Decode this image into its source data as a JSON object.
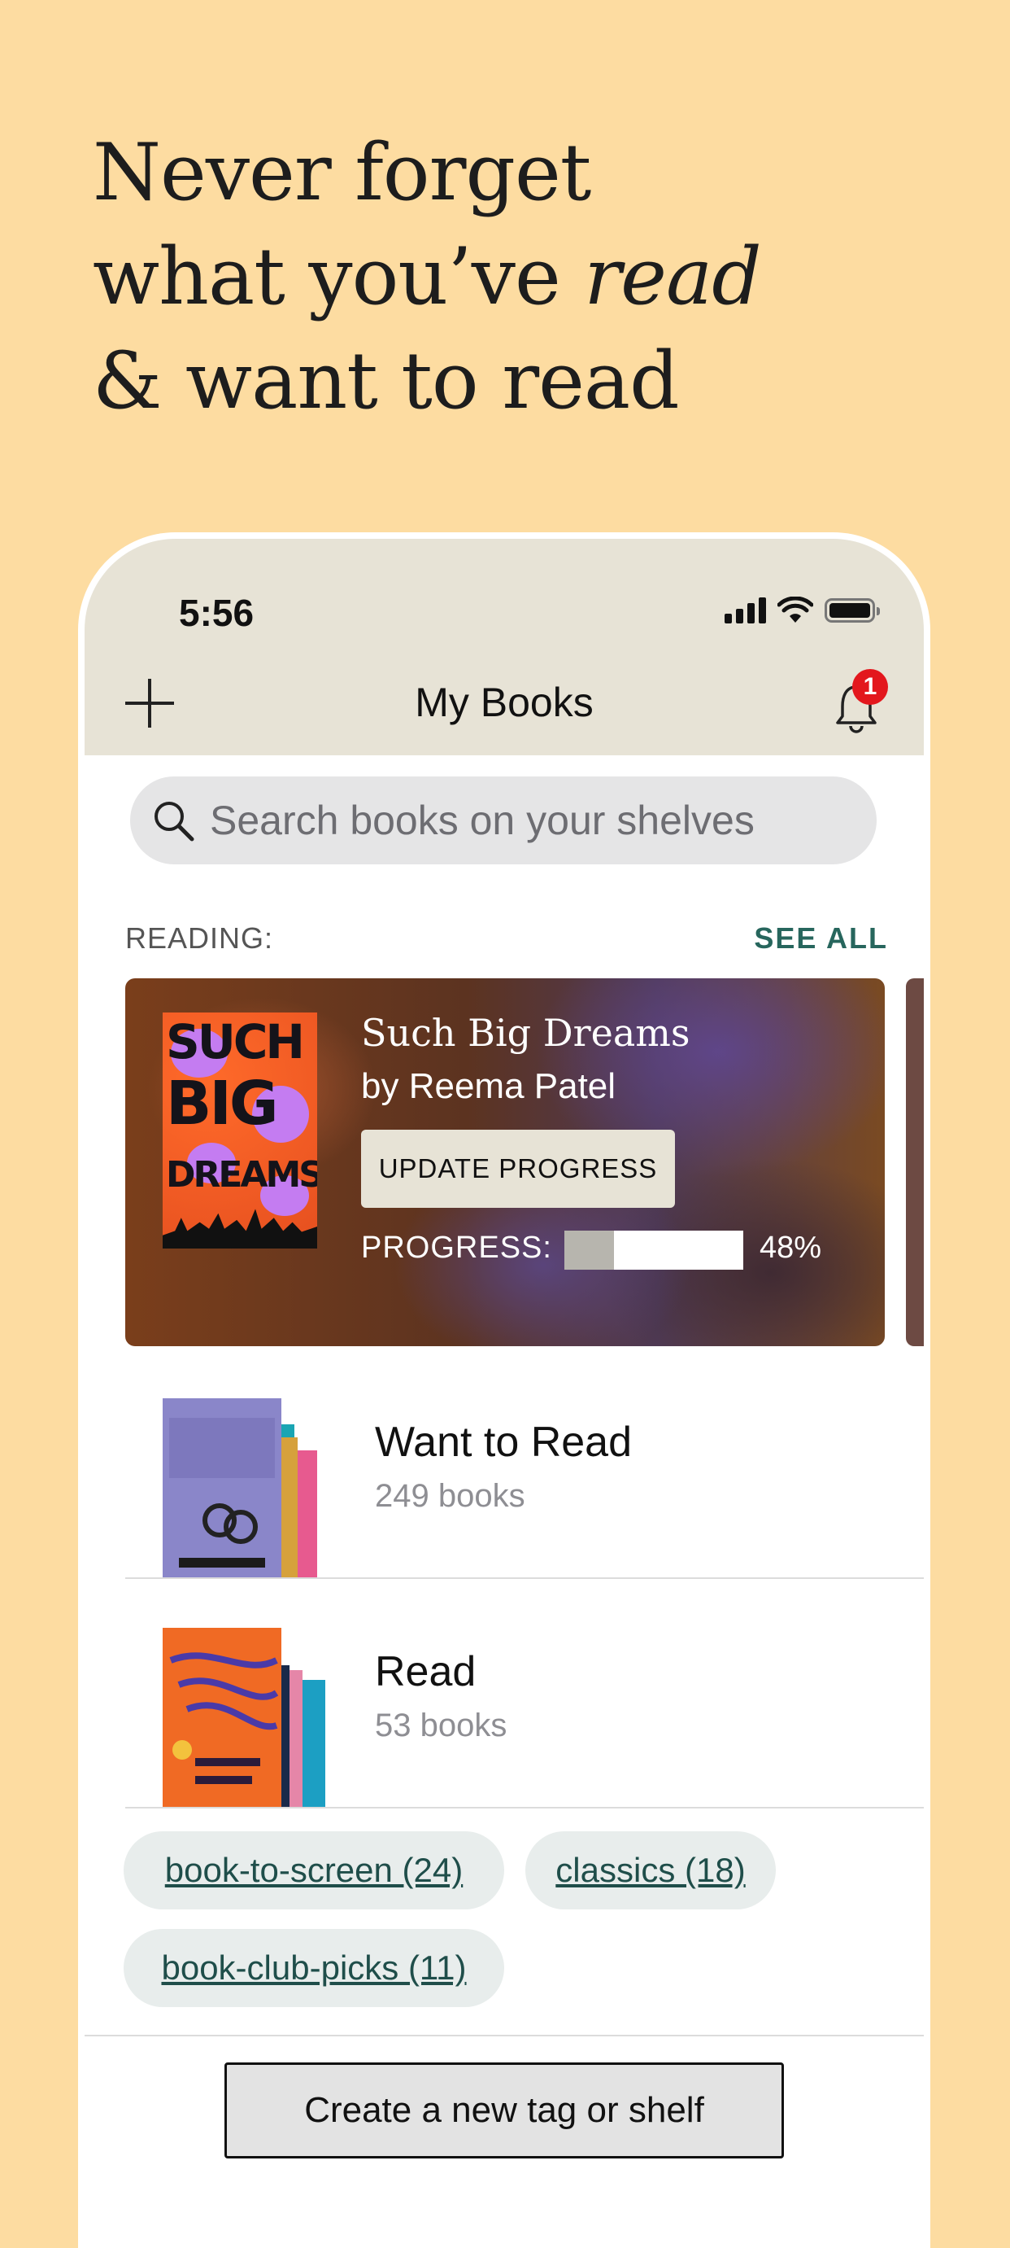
{
  "headline": {
    "line1": "Never forget",
    "line2_prefix": "what you’ve ",
    "line2_emphasis": "read",
    "line3": "& want to read"
  },
  "status_bar": {
    "time": "5:56"
  },
  "nav": {
    "title": "My Books",
    "add_icon": "plus-icon",
    "bell_icon": "bell-icon",
    "notification_count": "1"
  },
  "search": {
    "placeholder": "Search books on your shelves",
    "value": ""
  },
  "reading": {
    "label": "READING:",
    "see_all": "SEE ALL",
    "book": {
      "title": "Such Big Dreams",
      "author": "by Reema Patel",
      "cover_text": [
        "SUCH",
        "BIG",
        "DREAMS"
      ],
      "update_button": "UPDATE PROGRESS",
      "progress_label": "PROGRESS:",
      "progress_percent": 48,
      "progress_text": "48%"
    }
  },
  "shelves": [
    {
      "name": "Want to Read",
      "count": "249 books"
    },
    {
      "name": "Read",
      "count": "53 books"
    }
  ],
  "tags": [
    {
      "label": "book-to-screen (24)"
    },
    {
      "label": "classics (18)"
    },
    {
      "label": "book-club-picks (11)"
    }
  ],
  "create_button": "Create a new tag or shelf",
  "colors": {
    "background": "#fddca1",
    "top_bar": "#e7e3d6",
    "accent_teal": "#27665d",
    "badge": "#e3171d"
  }
}
